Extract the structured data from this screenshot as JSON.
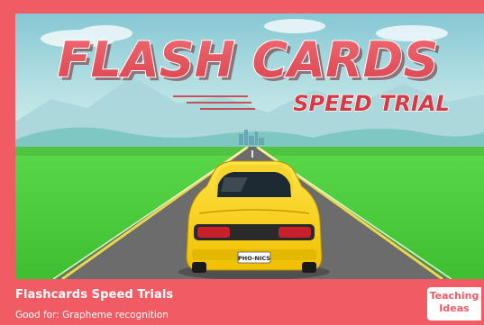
{
  "hero": {
    "headline": "FLASH CARDS",
    "subheadline": "SPEED TRIAL",
    "license_plate": "PHO-NICS"
  },
  "card": {
    "title": "Flashcards Speed Trials",
    "good_for": "Good for: Grapheme recognition"
  },
  "badge": {
    "line1": "Teaching",
    "line2": "Ideas"
  },
  "colors": {
    "card_background": "#f15b63",
    "headline_fill": "#e8505a",
    "subheadline_fill": "#d63a44",
    "sky": "#9fd3da",
    "grass": "#49c93a",
    "road": "#6c6c6c",
    "car_body": "#f6d21a"
  }
}
